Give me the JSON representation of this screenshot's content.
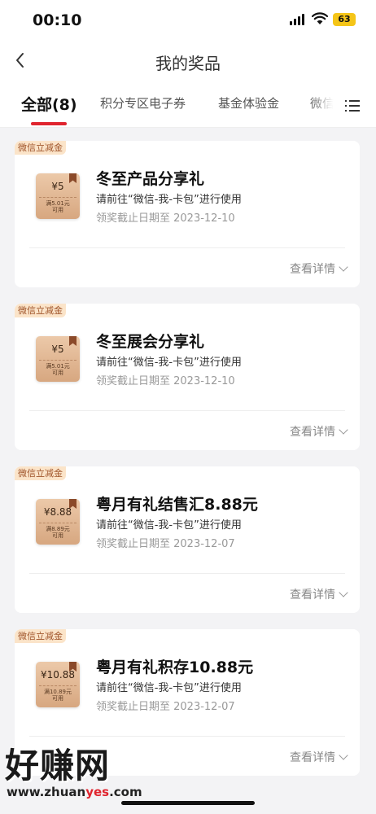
{
  "status": {
    "time": "00:10",
    "battery": "63"
  },
  "nav": {
    "title": "我的奖品"
  },
  "tabs": [
    {
      "label": "全部(8)"
    },
    {
      "label": "积分专区电子券"
    },
    {
      "label": "基金体验金"
    },
    {
      "label": "微信"
    }
  ],
  "cards": [
    {
      "tag": "微信立减金",
      "amount": "¥5",
      "note_line1": "满5.01元",
      "note_line2": "可用",
      "title": "冬至产品分享礼",
      "instruction": "请前往“微信-我-卡包”进行使用",
      "deadline": "领奖截止日期至 2023-12-10",
      "detail": "查看详情"
    },
    {
      "tag": "微信立减金",
      "amount": "¥5",
      "note_line1": "满5.01元",
      "note_line2": "可用",
      "title": "冬至展会分享礼",
      "instruction": "请前往“微信-我-卡包”进行使用",
      "deadline": "领奖截止日期至 2023-12-10",
      "detail": "查看详情"
    },
    {
      "tag": "微信立减金",
      "amount": "¥8.88",
      "note_line1": "满8.89元",
      "note_line2": "可用",
      "title": "粤月有礼结售汇8.88元",
      "instruction": "请前往“微信-我-卡包”进行使用",
      "deadline": "领奖截止日期至 2023-12-07",
      "detail": "查看详情"
    },
    {
      "tag": "微信立减金",
      "amount": "¥10.88",
      "note_line1": "满10.89元",
      "note_line2": "可用",
      "title": "粤月有礼积存10.88元",
      "instruction": "请前往“微信-我-卡包”进行使用",
      "deadline": "领奖截止日期至 2023-12-07",
      "detail": "查看详情"
    }
  ],
  "watermark": {
    "text": "好赚网",
    "url_prefix": "www.zhuan",
    "url_highlight": "yes",
    "url_suffix": ".com"
  }
}
